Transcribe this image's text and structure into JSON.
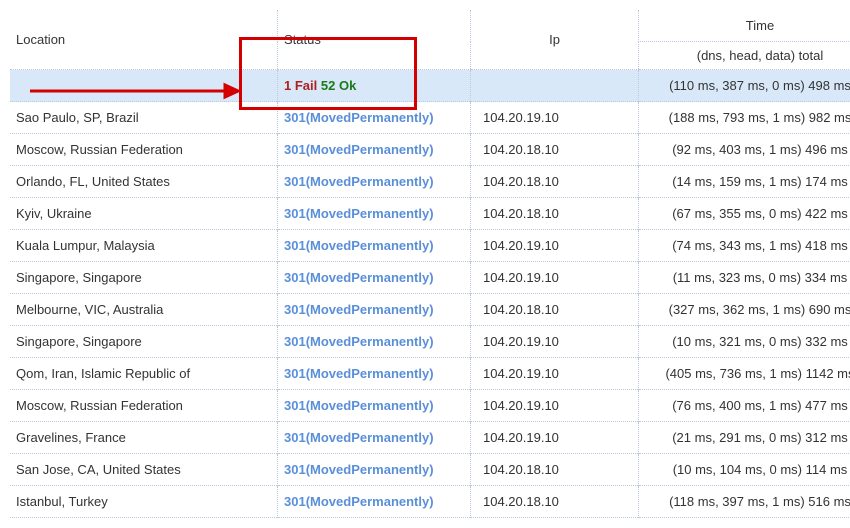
{
  "header": {
    "location": "Location",
    "status": "Status",
    "ip": "Ip",
    "time": "Time",
    "time_sub": "(dns, head, data) total"
  },
  "summary": {
    "location": "",
    "fail_count": "1",
    "fail_label": "Fail",
    "ok_count": "52",
    "ok_label": "Ok",
    "ip": "",
    "time": "(110 ms, 387 ms, 0 ms) 498 ms"
  },
  "rows": [
    {
      "location": "Sao Paulo, SP, Brazil",
      "status": "301(MovedPermanently)",
      "ip": "104.20.19.10",
      "time": "(188 ms, 793 ms, 1 ms) 982 ms"
    },
    {
      "location": "Moscow, Russian Federation",
      "status": "301(MovedPermanently)",
      "ip": "104.20.18.10",
      "time": "(92 ms, 403 ms, 1 ms) 496 ms"
    },
    {
      "location": "Orlando, FL, United States",
      "status": "301(MovedPermanently)",
      "ip": "104.20.18.10",
      "time": "(14 ms, 159 ms, 1 ms) 174 ms"
    },
    {
      "location": "Kyiv, Ukraine",
      "status": "301(MovedPermanently)",
      "ip": "104.20.18.10",
      "time": "(67 ms, 355 ms, 0 ms) 422 ms"
    },
    {
      "location": "Kuala Lumpur, Malaysia",
      "status": "301(MovedPermanently)",
      "ip": "104.20.19.10",
      "time": "(74 ms, 343 ms, 1 ms) 418 ms"
    },
    {
      "location": "Singapore, Singapore",
      "status": "301(MovedPermanently)",
      "ip": "104.20.19.10",
      "time": "(11 ms, 323 ms, 0 ms) 334 ms"
    },
    {
      "location": "Melbourne, VIC, Australia",
      "status": "301(MovedPermanently)",
      "ip": "104.20.18.10",
      "time": "(327 ms, 362 ms, 1 ms) 690 ms"
    },
    {
      "location": "Singapore, Singapore",
      "status": "301(MovedPermanently)",
      "ip": "104.20.19.10",
      "time": "(10 ms, 321 ms, 0 ms) 332 ms"
    },
    {
      "location": "Qom, Iran, Islamic Republic of",
      "status": "301(MovedPermanently)",
      "ip": "104.20.19.10",
      "time": "(405 ms, 736 ms, 1 ms) 1142 ms"
    },
    {
      "location": "Moscow, Russian Federation",
      "status": "301(MovedPermanently)",
      "ip": "104.20.19.10",
      "time": "(76 ms, 400 ms, 1 ms) 477 ms"
    },
    {
      "location": "Gravelines, France",
      "status": "301(MovedPermanently)",
      "ip": "104.20.19.10",
      "time": "(21 ms, 291 ms, 0 ms) 312 ms"
    },
    {
      "location": "San Jose, CA, United States",
      "status": "301(MovedPermanently)",
      "ip": "104.20.18.10",
      "time": "(10 ms, 104 ms, 0 ms) 114 ms"
    },
    {
      "location": "Istanbul, Turkey",
      "status": "301(MovedPermanently)",
      "ip": "104.20.18.10",
      "time": "(118 ms, 397 ms, 1 ms) 516 ms"
    }
  ]
}
